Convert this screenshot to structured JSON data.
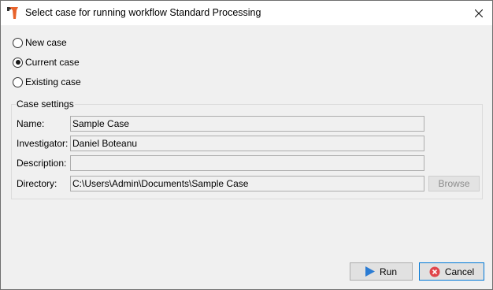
{
  "window": {
    "title": "Select case for running workflow Standard Processing"
  },
  "case_mode": {
    "options": [
      {
        "label": "New case",
        "checked": false
      },
      {
        "label": "Current case",
        "checked": true
      },
      {
        "label": "Existing case",
        "checked": false
      }
    ]
  },
  "case_settings": {
    "legend": "Case settings",
    "name_label": "Name:",
    "name_value": "Sample Case",
    "investigator_label": "Investigator:",
    "investigator_value": "Daniel Boteanu",
    "description_label": "Description:",
    "description_value": "",
    "directory_label": "Directory:",
    "directory_value": "C:\\Users\\Admin\\Documents\\Sample Case",
    "browse_label": "Browse"
  },
  "buttons": {
    "run_label": "Run",
    "cancel_label": "Cancel"
  },
  "icons": {
    "app": "workflow-app-icon",
    "close": "close-icon",
    "run": "play-icon",
    "cancel": "cancel-circle-icon"
  },
  "colors": {
    "run_icon": "#2b7cd3",
    "cancel_icon": "#e0454b",
    "app_icon": "#e8632b",
    "focus_border": "#0078d7"
  }
}
